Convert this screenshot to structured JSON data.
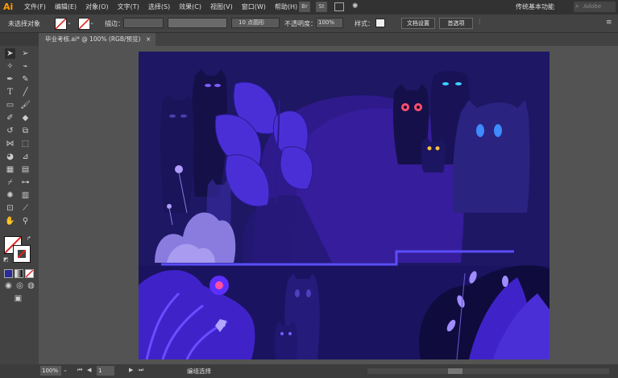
{
  "app": {
    "logo": "Ai",
    "workspace": "传统基本功能",
    "search_placeholder": "Adobe"
  },
  "menu": [
    "文件(F)",
    "编辑(E)",
    "对象(O)",
    "文字(T)",
    "选择(S)",
    "效果(C)",
    "视图(V)",
    "窗口(W)",
    "帮助(H)"
  ],
  "bridge_buttons": [
    "Br",
    "St"
  ],
  "control": {
    "selection_label": "未选择对象",
    "stroke_label": "描边：",
    "brush_value": "10 点圆形",
    "opacity_label": "不透明度：",
    "opacity_value": "100%",
    "style_label": "样式：",
    "doc_settings": "文档设置",
    "preferences": "首选项"
  },
  "tab": {
    "title": "毕业考核.ai* @ 100% (RGB/预览)",
    "close": "×"
  },
  "status": {
    "zoom": "100%",
    "page": "1",
    "state": "编组选择"
  },
  "colors": {
    "accent": "#ff9a00",
    "artboard_bg": "#1d1764",
    "ui_dark": "#323232"
  },
  "icons": [
    "selection-tool",
    "direct-selection-tool",
    "magic-wand-tool",
    "lasso-tool",
    "pen-tool",
    "curvature-tool",
    "type-tool",
    "line-tool",
    "rectangle-tool",
    "paintbrush-tool",
    "shaper-tool",
    "eraser-tool",
    "rotate-tool",
    "scale-tool",
    "width-tool",
    "free-transform-tool",
    "shape-builder-tool",
    "perspective-tool",
    "mesh-tool",
    "gradient-tool",
    "eyedropper-tool",
    "blend-tool",
    "symbol-sprayer-tool",
    "column-graph-tool",
    "artboard-tool",
    "slice-tool",
    "hand-tool",
    "zoom-tool"
  ]
}
